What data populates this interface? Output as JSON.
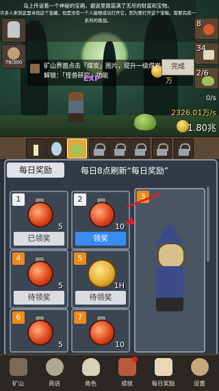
{
  "announcement": {
    "line1": "岛上传说着一个神秘的宝箱，据说里面装满了无尽的财富和宝物。",
    "line2": "许多人来到这里寻找这个宝藏，但是没有一个人能够成功打开它，因为要打开这个宝箱，需要完成一系列的挑战。"
  },
  "left_panel": {
    "hp": "78/300"
  },
  "info_bar": {
    "line1": "矿山界面点击「煤炭」图片，提升一级煤炭品质",
    "line2": "解锁：「怪兽研究」功能",
    "gold_gain": "+651.25万",
    "complete_label": "完成"
  },
  "exp_label": "EXP",
  "right_panel": {
    "slot1_num": "8",
    "slot2_num": "34",
    "slot3_num": "2/6",
    "rate": "0/s",
    "gold": "2326.01万/s",
    "total": "1.80兆"
  },
  "daily": {
    "tab_label": "每日奖励",
    "refresh_text": "每日8点刷新“每日奖励”",
    "cards": [
      {
        "num": "1",
        "qty": "5",
        "button": "已领奖",
        "type": "potion"
      },
      {
        "num": "2",
        "qty": "10",
        "button": "领奖",
        "type": "potion"
      },
      {
        "num": "4",
        "qty": "5",
        "button": "待领奖",
        "type": "potion"
      },
      {
        "num": "5",
        "qty": "1H",
        "button": "待领奖",
        "type": "coin"
      },
      {
        "num": "6",
        "qty": "5",
        "button": "",
        "type": "potion"
      },
      {
        "num": "7",
        "qty": "10",
        "button": "",
        "type": "potion"
      }
    ],
    "big_card_num": "3"
  },
  "nav": [
    {
      "label": "矿山",
      "icon": "mine-icon"
    },
    {
      "label": "商店",
      "icon": "shop-icon"
    },
    {
      "label": "角色",
      "icon": "skull-icon"
    },
    {
      "label": "成就",
      "icon": "achievement-icon"
    },
    {
      "label": "每日奖励",
      "icon": "daily-reward-icon"
    },
    {
      "label": "设置",
      "icon": "settings-gear-icon"
    }
  ],
  "colors": {
    "accent_blue": "#3a8df0",
    "number_orange": "#f08a1a",
    "gold_text": "#ffd24a",
    "exp_purple": "#cf7bff"
  }
}
